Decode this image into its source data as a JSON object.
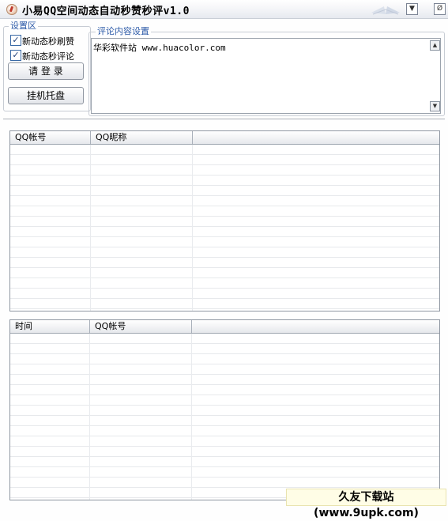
{
  "window": {
    "title": "小易QQ空间动态自动秒赞秒评v1.0"
  },
  "settings": {
    "group_title": "设置区",
    "option_like": "新动态秒刷赞",
    "option_comment": "新动态秒评论",
    "login_button": "请 登 录",
    "tray_button": "挂机托盘"
  },
  "comment": {
    "group_title": "评论内容设置",
    "text": "华彩软件站 www.huacolor.com"
  },
  "accounts_table": {
    "columns": [
      "QQ帐号",
      "QQ昵称"
    ]
  },
  "log_table": {
    "columns": [
      "时间",
      "QQ帐号"
    ]
  },
  "watermark": "久友下载站(www.9upk.com)",
  "colors": {
    "accent": "#2c5aa8",
    "grid_line": "#e7e9ec",
    "border": "#8f97a2"
  },
  "icons": [
    "app-icon",
    "minimize-icon",
    "close-icon",
    "check-icon",
    "scroll-up-icon",
    "scroll-down-icon"
  ]
}
